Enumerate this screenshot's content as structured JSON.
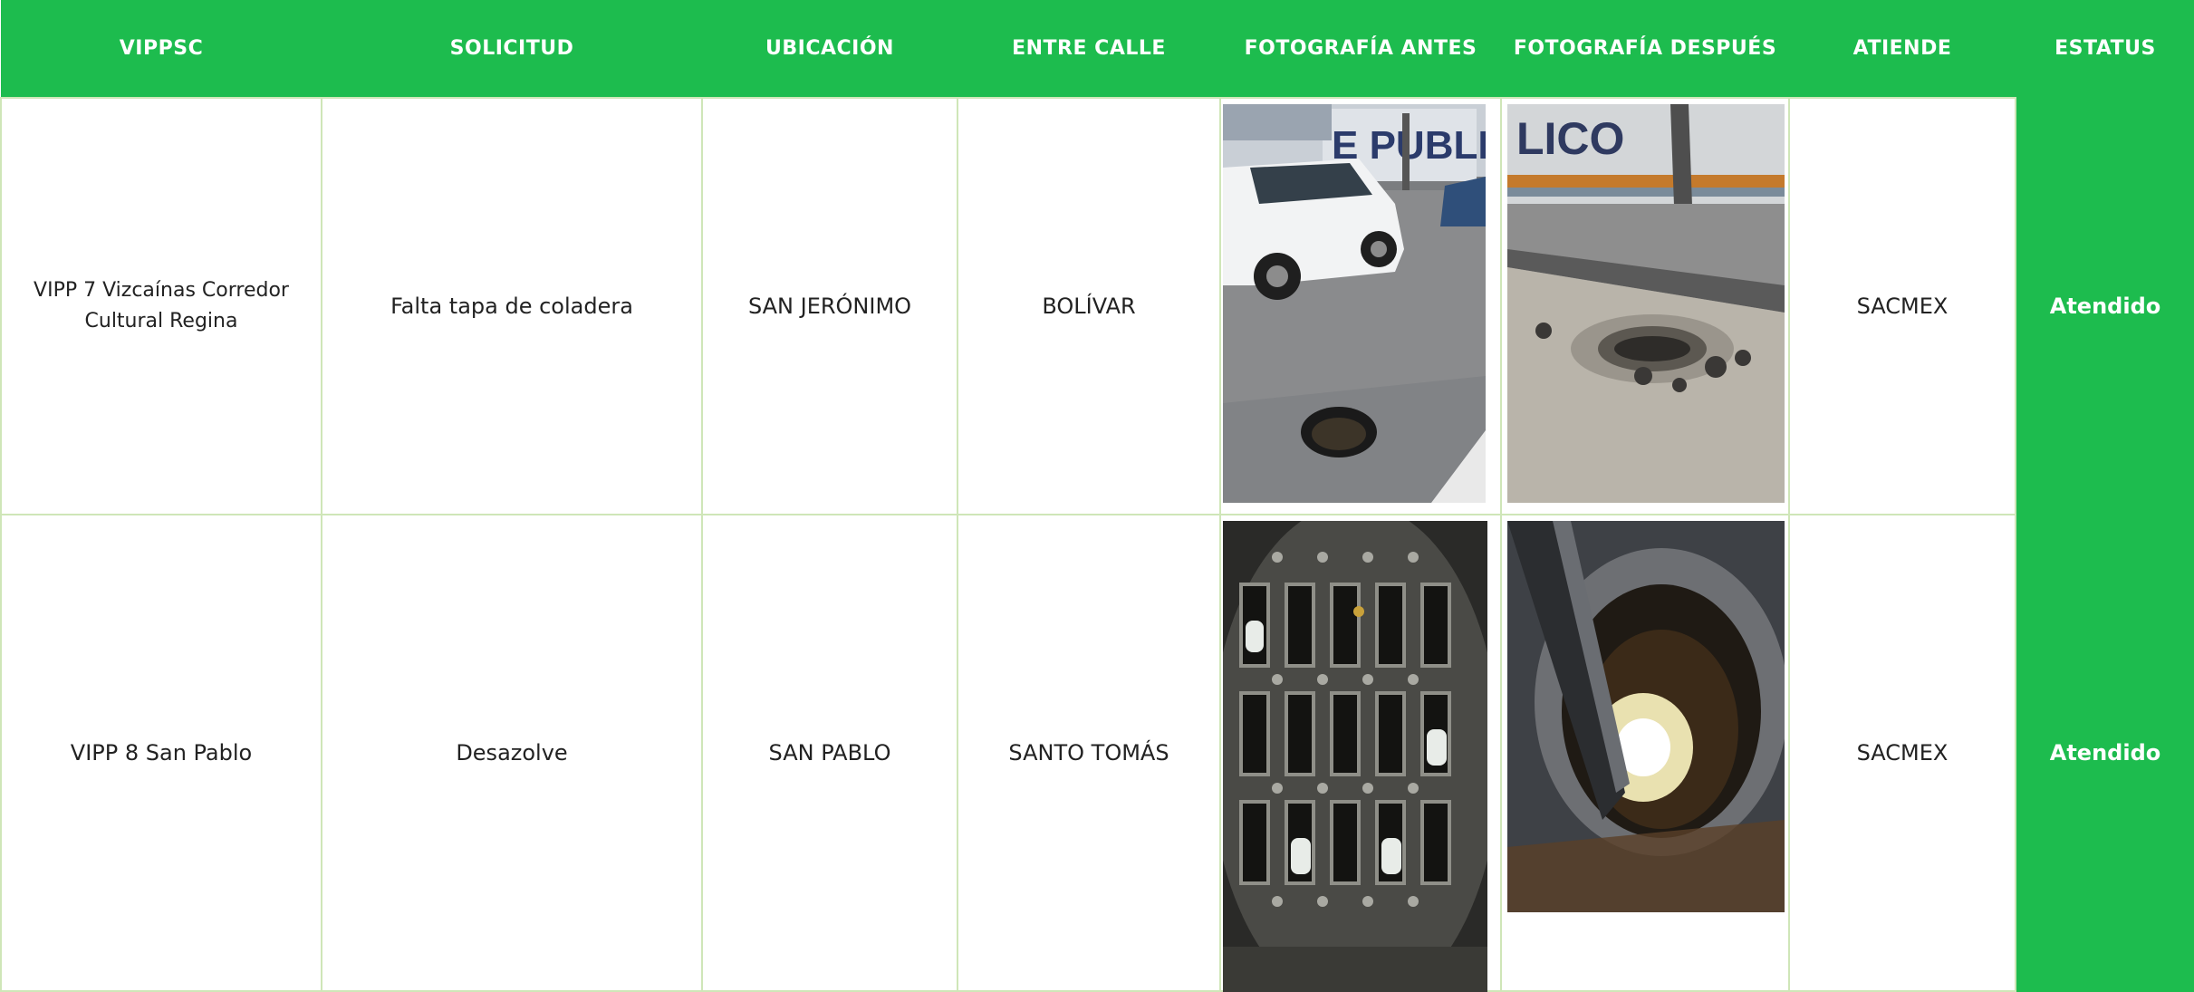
{
  "headers": [
    "VIPPSC",
    "SOLICITUD",
    "UBICACIÓN",
    "ENTRE CALLE",
    "FOTOGRAFÍA ANTES",
    "FOTOGRAFÍA DESPUÉS",
    "ATIENDE",
    "ESTATUS"
  ],
  "rows": [
    {
      "vippsc": "VIPP 7 Vizcaínas Corredor Cultural Regina",
      "solicitud": "Falta tapa de coladera",
      "ubicacion": "SAN JERÓNIMO",
      "entre_calle": "BOLÍVAR",
      "foto_antes_text": "E PUBLICO",
      "foto_despues_text": "LICO",
      "atiende": "SACMEX",
      "estatus": "Atendido"
    },
    {
      "vippsc": "VIPP 8 San Pablo",
      "solicitud": "Desazolve",
      "ubicacion": "SAN PABLO",
      "entre_calle": "SANTO TOMÁS",
      "atiende": "SACMEX",
      "estatus": "Atendido"
    }
  ],
  "colors": {
    "header": "#1dbc4e",
    "status": "#1dbc4e",
    "grid": "#cfe6b8"
  }
}
